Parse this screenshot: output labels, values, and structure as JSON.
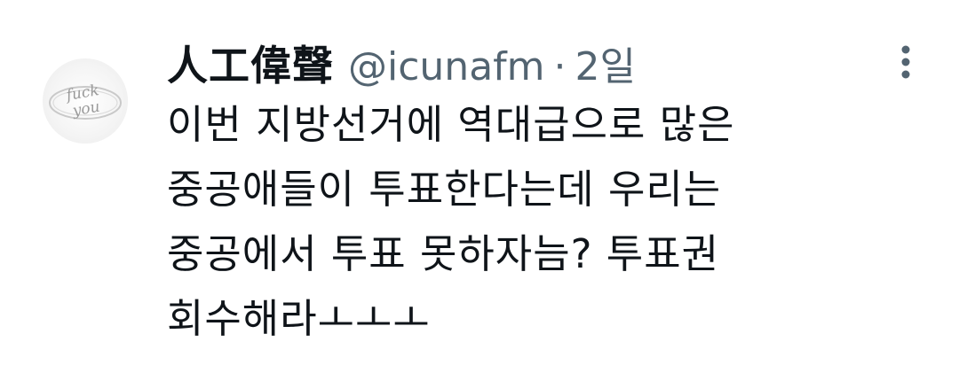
{
  "tweet": {
    "author": {
      "display_name": "人工偉聲",
      "handle": "@icunafm",
      "avatar_text": "fuck you"
    },
    "separator": "·",
    "time": "2일",
    "lines": [
      "이번 지방선거에 역대급으로 많은",
      "중공애들이 투표한다는데 우리는",
      "중공에서 투표 못하자늠? 투표권",
      "회수해라ㅗㅗㅗ"
    ],
    "more_icon": "more-vertical-icon"
  }
}
